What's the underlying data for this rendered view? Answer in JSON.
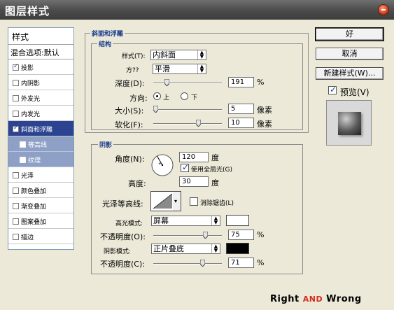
{
  "window": {
    "title": "图层样式"
  },
  "sidebar": {
    "heading": "样式",
    "blend_options": "混合选项:默认",
    "effects": [
      {
        "label": "投影",
        "checked": true,
        "state": "normal"
      },
      {
        "label": "内阴影",
        "checked": false,
        "state": "normal"
      },
      {
        "label": "外发光",
        "checked": false,
        "state": "normal"
      },
      {
        "label": "内发光",
        "checked": false,
        "state": "normal"
      },
      {
        "label": "斜面和浮雕",
        "checked": true,
        "state": "selected"
      },
      {
        "label": "等高线",
        "checked": false,
        "state": "sub"
      },
      {
        "label": "纹理",
        "checked": false,
        "state": "sub"
      },
      {
        "label": "光泽",
        "checked": false,
        "state": "normal"
      },
      {
        "label": "颜色叠加",
        "checked": false,
        "state": "normal"
      },
      {
        "label": "渐变叠加",
        "checked": false,
        "state": "normal"
      },
      {
        "label": "图案叠加",
        "checked": false,
        "state": "normal"
      },
      {
        "label": "描边",
        "checked": false,
        "state": "normal"
      }
    ]
  },
  "bevel": {
    "group_title": "斜面和浮雕",
    "structure_title": "结构",
    "style_label": "样式(T):",
    "style_value": "内斜面",
    "technique_label": "方??",
    "technique_value": "平滑",
    "depth_label": "深度(D):",
    "depth_value": "191",
    "depth_unit": "%",
    "depth_level": 0.19,
    "direction_label": "方向:",
    "direction_up": "上",
    "direction_down": "下",
    "direction_selected": "上",
    "size_label": "大小(S):",
    "size_value": "5",
    "size_unit": "像素",
    "size_level": 0.03,
    "soften_label": "软化(F):",
    "soften_value": "10",
    "soften_unit": "像素",
    "soften_level": 0.65
  },
  "shading": {
    "group_title": "阴影",
    "angle_label": "角度(N):",
    "angle_value": "120",
    "angle_unit": "度",
    "global_light_label": "使用全局光(G)",
    "global_light_checked": true,
    "altitude_label": "高度:",
    "altitude_value": "30",
    "altitude_unit": "度",
    "gloss_contour_label": "光泽等高线:",
    "anti_alias_label": "消除锯齿(L)",
    "anti_alias_checked": false,
    "highlight_mode_label": "高光模式:",
    "highlight_mode_value": "屏幕",
    "highlight_color": "#ffffff",
    "highlight_opacity_label": "不透明度(O):",
    "highlight_opacity_value": "75",
    "highlight_opacity_unit": "%",
    "highlight_opacity_level": 0.75,
    "shadow_mode_label": "阴影模式:",
    "shadow_mode_value": "正片叠底",
    "shadow_color": "#000000",
    "shadow_opacity_label": "不透明度(C):",
    "shadow_opacity_value": "71",
    "shadow_opacity_unit": "%",
    "shadow_opacity_level": 0.71
  },
  "buttons": {
    "ok": "好",
    "cancel": "取消",
    "new_style": "新建样式(W)...",
    "preview_label": "预览(V)",
    "preview_checked": true
  },
  "watermark": {
    "word1": "Right",
    "word2": "and",
    "word3": "Wrong"
  },
  "colors": {
    "titlebar": "#4f4f4f",
    "selection": "#2b4391",
    "sub_item": "#8ea0c6",
    "accent_text": "#1a3c8c",
    "watermark_red": "#d42a1e"
  }
}
